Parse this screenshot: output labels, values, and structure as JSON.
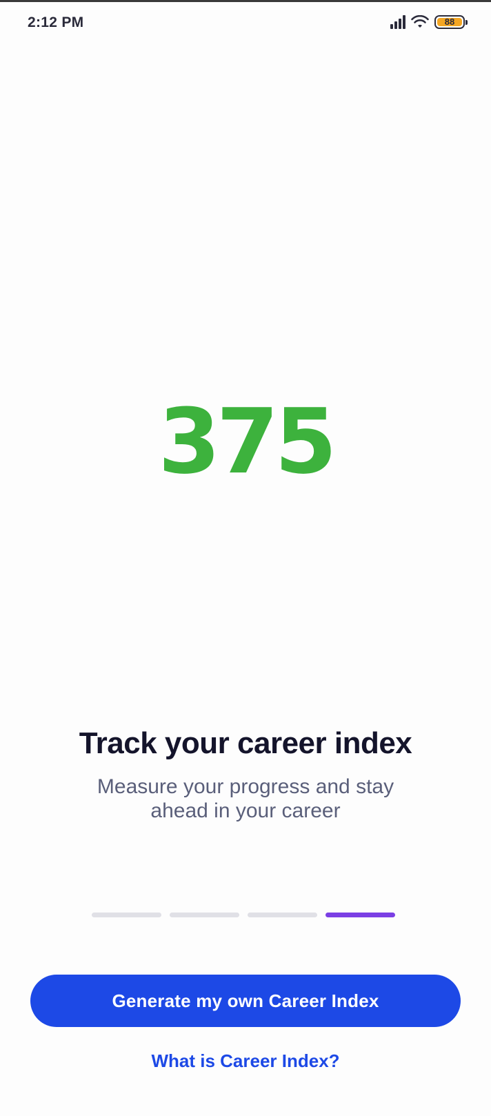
{
  "status_bar": {
    "time": "2:12 PM",
    "battery_level": "88",
    "icons": [
      "signal-icon",
      "wifi-icon",
      "battery-icon"
    ],
    "battery_color": "#f4a623"
  },
  "hero": {
    "score": "375",
    "score_color": "#3db23d"
  },
  "content": {
    "title": "Track your career index",
    "subtitle": "Measure your progress and stay ahead in your career"
  },
  "pager": {
    "total": 4,
    "active_index": 3,
    "active_color": "#7b3fe4"
  },
  "actions": {
    "primary_label": "Generate my own Career Index",
    "secondary_label": "What is Career Index?",
    "accent_color": "#1d49e6"
  }
}
